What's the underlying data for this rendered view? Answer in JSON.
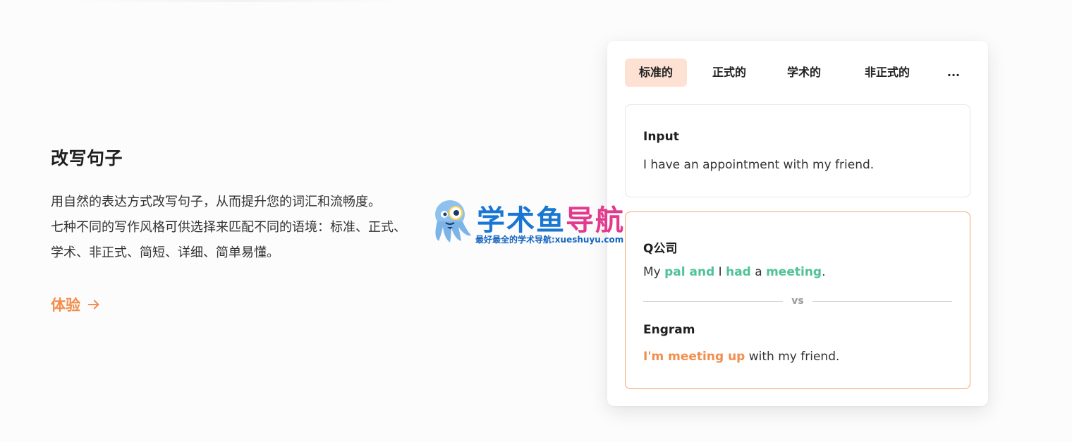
{
  "feature": {
    "title": "改写句子",
    "description_lines": [
      "用自然的表达方式改写句子，从而提升您的词汇和流畅度。",
      "七种不同的写作风格可供选择来匹配不同的语境：标准、正式、",
      "学术、非正式、简短、详细、简单易懂。"
    ],
    "cta_label": "体验",
    "cta_icon": "arrow-right-icon"
  },
  "demo": {
    "tabs": [
      {
        "label": "标准的",
        "active": true
      },
      {
        "label": "正式的",
        "active": false
      },
      {
        "label": "学术的",
        "active": false
      },
      {
        "label": "非正式的",
        "active": false
      },
      {
        "label": "...",
        "active": false
      }
    ],
    "input": {
      "label": "Input",
      "text": "I have an appointment with my friend."
    },
    "competitor": {
      "label": "Q公司",
      "parts": [
        "My ",
        "pal and",
        " I ",
        "had",
        " a ",
        "meeting",
        "."
      ]
    },
    "vs_label": "vs",
    "engram": {
      "label": "Engram",
      "parts": [
        "I'm meeting up",
        " with my friend."
      ]
    }
  },
  "watermark": {
    "title_part1": "学术鱼",
    "title_part2": "导航",
    "subtitle": "最好最全的学术导航:xueshuyu.com"
  },
  "colors": {
    "accent_orange": "#f28d4b",
    "highlight_green": "#4fc296",
    "active_tab_bg": "#fde1d3"
  }
}
